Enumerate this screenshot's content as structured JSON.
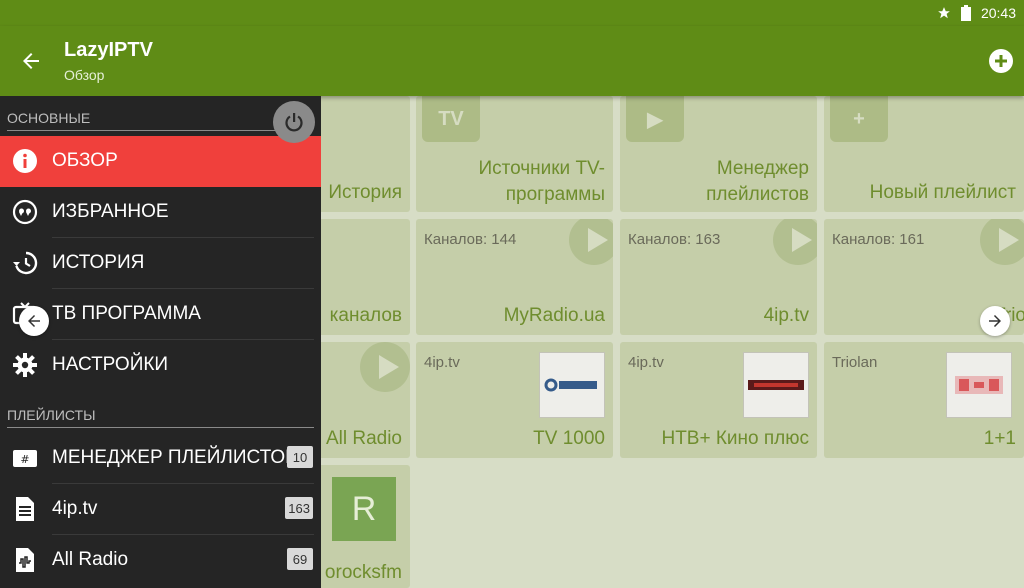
{
  "status_bar": {
    "time": "20:43",
    "icons": [
      "star-icon",
      "battery-icon"
    ]
  },
  "app_bar": {
    "title": "LazyIPTV",
    "subtitle": "Обзор",
    "back_icon": "arrow-back-icon",
    "action_icon": "add-circle-icon"
  },
  "drawer": {
    "sections": [
      {
        "header": "ОСНОВНЫЕ",
        "items": [
          {
            "label": "ОБЗОР",
            "icon": "info-icon",
            "active": true
          },
          {
            "label": "ИЗБРАННОЕ",
            "icon": "quote-icon",
            "active": false
          },
          {
            "label": "ИСТОРИЯ",
            "icon": "history-icon",
            "active": false
          },
          {
            "label": "ТВ ПРОГРАММА",
            "icon": "tv-guide-icon",
            "active": false
          },
          {
            "label": "НАСТРОЙКИ",
            "icon": "gear-icon",
            "active": false
          }
        ]
      },
      {
        "header": "ПЛЕЙЛИСТЫ",
        "items": [
          {
            "label": "МЕНЕДЖЕР ПЛЕЙЛИСТОВ",
            "icon": "playlist-manager-icon",
            "badge": "10"
          },
          {
            "label": "4ip.tv",
            "icon": "document-icon",
            "badge": "163"
          },
          {
            "label": "All Radio",
            "icon": "audio-file-icon",
            "badge": "69"
          }
        ]
      }
    ]
  },
  "tiles": {
    "row1": [
      {
        "name": "История"
      },
      {
        "name": "Источники TV-программы"
      },
      {
        "name": "Менеджер плейлистов"
      },
      {
        "name": "Новый плейлист"
      }
    ],
    "row2": [
      {
        "name": "каналов"
      },
      {
        "name": "MyRadio.ua",
        "count": "Каналов: 144"
      },
      {
        "name": "4ip.tv",
        "count": "Каналов: 163"
      },
      {
        "name": "Trio",
        "count": "Каналов: 161"
      }
    ],
    "row3": [
      {
        "name": "All Radio"
      },
      {
        "name": "TV 1000",
        "provider": "4ip.tv"
      },
      {
        "name": "НТВ+ Кино плюс",
        "provider": "4ip.tv"
      },
      {
        "name": "1+1",
        "provider": "Triolan"
      }
    ],
    "row4": [
      {
        "name": "orocksfm",
        "letter": "R"
      }
    ]
  },
  "colors": {
    "primary": "#5f8c16",
    "active": "#f0403c",
    "drawer_bg": "#252525",
    "tile_bg": "#c5cea9"
  }
}
